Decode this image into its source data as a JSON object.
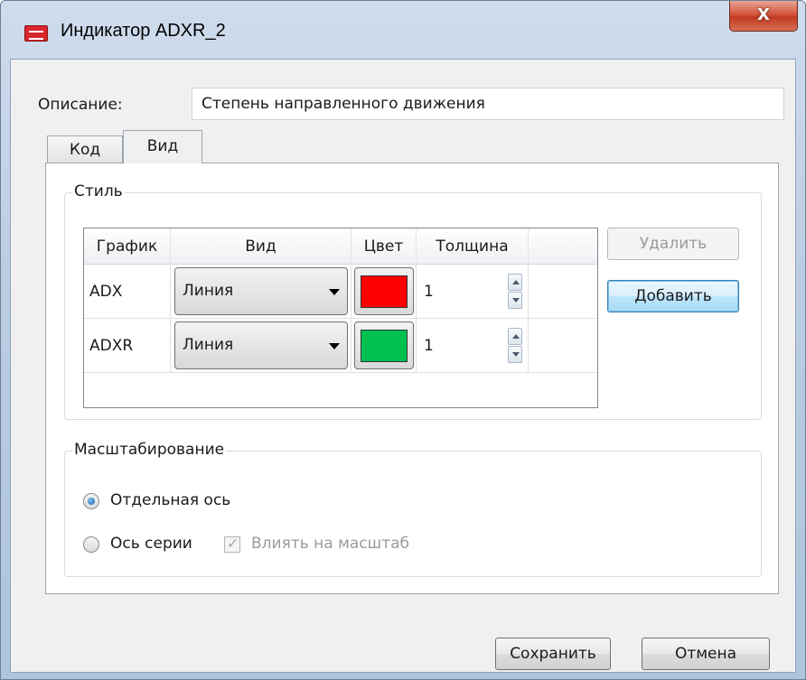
{
  "window": {
    "title": "Индикатор ADXR_2",
    "close_glyph": "X"
  },
  "description": {
    "label": "Описание:",
    "value": "Степень направленного движения"
  },
  "tabs": [
    {
      "label": "Код",
      "active": false
    },
    {
      "label": "Вид",
      "active": true
    }
  ],
  "style_group": {
    "legend": "Стиль",
    "grid": {
      "columns": [
        "График",
        "Вид",
        "Цвет",
        "Толщина"
      ],
      "rows": [
        {
          "name": "ADX",
          "type": "Линия",
          "color": "#ff0000",
          "thickness": "1"
        },
        {
          "name": "ADXR",
          "type": "Линия",
          "color": "#00c050",
          "thickness": "1"
        }
      ]
    },
    "delete_button": "Удалить",
    "add_button": "Добавить"
  },
  "scaling_group": {
    "legend": "Масштабирование",
    "options": [
      {
        "label": "Отдельная ось",
        "checked": true
      },
      {
        "label": "Ось серии",
        "checked": false
      }
    ],
    "affect_scale": {
      "label": "Влиять на масштаб",
      "checked": true,
      "disabled": true
    }
  },
  "footer": {
    "save_button": "Сохранить",
    "cancel_button": "Отмена"
  }
}
